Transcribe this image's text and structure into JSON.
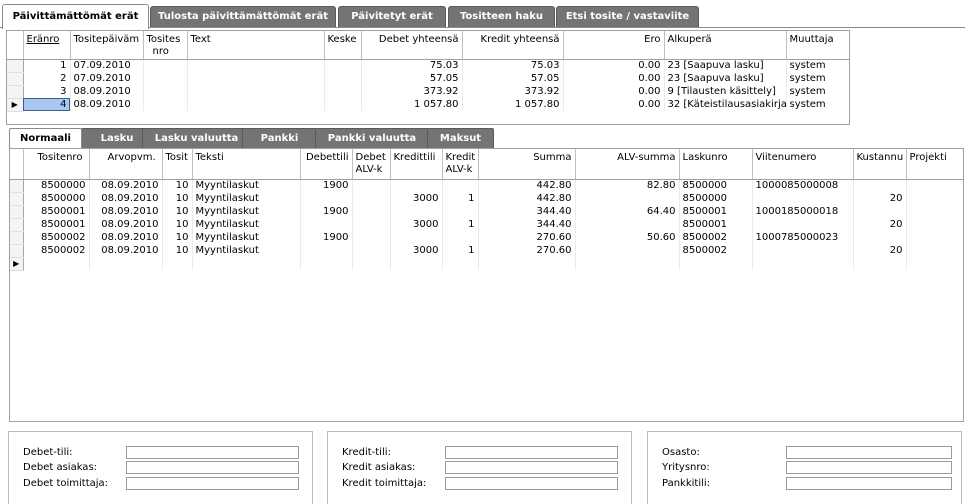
{
  "tabs": [
    {
      "label": "Päivittämättömät erät"
    },
    {
      "label": "Tulosta päivittämättömät erät"
    },
    {
      "label": "Päivitetyt erät"
    },
    {
      "label": "Tositteen haku"
    },
    {
      "label": "Etsi tosite / vastaviite"
    }
  ],
  "batch_grid": {
    "columns": {
      "erano": "Eränro",
      "date": "Tositepäiväm",
      "tosites": "Tosites",
      "tosites2": "nro",
      "text": "Text",
      "keske": "Keske",
      "debet": "Debet yhteensä",
      "kredit": "Kredit yhteensä",
      "ero": "Ero",
      "alkupera": "Alkuperä",
      "muuttaja": "Muuttaja"
    },
    "rows": [
      {
        "erano": "1",
        "date": "07.09.2010",
        "tosites": "",
        "text": "",
        "keske": "",
        "debet": "75.03",
        "kredit": "75.03",
        "ero": "0.00",
        "alkupera": "23 [Saapuva lasku]",
        "muuttaja": "system"
      },
      {
        "erano": "2",
        "date": "07.09.2010",
        "tosites": "",
        "text": "",
        "keske": "",
        "debet": "57.05",
        "kredit": "57.05",
        "ero": "0.00",
        "alkupera": "23 [Saapuva lasku]",
        "muuttaja": "system"
      },
      {
        "erano": "3",
        "date": "08.09.2010",
        "tosites": "",
        "text": "",
        "keske": "",
        "debet": "373.92",
        "kredit": "373.92",
        "ero": "0.00",
        "alkupera": "9 [Tilausten käsittely]",
        "muuttaja": "system"
      },
      {
        "erano": "4",
        "date": "08.09.2010",
        "tosites": "",
        "text": "",
        "keske": "",
        "debet": "1 057.80",
        "kredit": "1 057.80",
        "ero": "0.00",
        "alkupera": "32 [Käteistilausasiakirja]",
        "muuttaja": "system"
      }
    ]
  },
  "subtabs": [
    {
      "label": "Normaali"
    },
    {
      "label": "Lasku"
    },
    {
      "label": "Lasku valuutta"
    },
    {
      "label": "Pankki"
    },
    {
      "label": "Pankki valuutta"
    },
    {
      "label": "Maksut"
    }
  ],
  "entry_grid": {
    "columns": {
      "tositenro": "Tositenro",
      "arvopvm": "Arvopvm.",
      "tosit": "Tosit",
      "teksti": "Teksti",
      "debettili": "Debettili",
      "debet_alv_1": "Debet",
      "debet_alv_2": "ALV-k",
      "kredittili": "Kredittili",
      "kredit_alv_1": "Kredit",
      "kredit_alv_2": "ALV-k",
      "summa": "Summa",
      "alv_summa": "ALV-summa",
      "laskunro": "Laskunro",
      "viitenumero": "Viitenumero",
      "kustannus": "Kustannu",
      "projekti": "Projekti"
    },
    "rows": [
      {
        "tositenro": "8500000",
        "arvopvm": "08.09.2010",
        "tosit": "10",
        "teksti": "Myyntilaskut",
        "debettili": "1900",
        "debet_alv": "",
        "kredittili": "",
        "kredit_alv": "",
        "summa": "442.80",
        "alv_summa": "82.80",
        "laskunro": "8500000",
        "viitenumero": "1000085000008",
        "kustannus": "",
        "projekti": ""
      },
      {
        "tositenro": "8500000",
        "arvopvm": "08.09.2010",
        "tosit": "10",
        "teksti": "Myyntilaskut",
        "debettili": "",
        "debet_alv": "",
        "kredittili": "3000",
        "kredit_alv": "1",
        "summa": "442.80",
        "alv_summa": "",
        "laskunro": "8500000",
        "viitenumero": "",
        "kustannus": "20",
        "projekti": ""
      },
      {
        "tositenro": "8500001",
        "arvopvm": "08.09.2010",
        "tosit": "10",
        "teksti": "Myyntilaskut",
        "debettili": "1900",
        "debet_alv": "",
        "kredittili": "",
        "kredit_alv": "",
        "summa": "344.40",
        "alv_summa": "64.40",
        "laskunro": "8500001",
        "viitenumero": "1000185000018",
        "kustannus": "",
        "projekti": ""
      },
      {
        "tositenro": "8500001",
        "arvopvm": "08.09.2010",
        "tosit": "10",
        "teksti": "Myyntilaskut",
        "debettili": "",
        "debet_alv": "",
        "kredittili": "3000",
        "kredit_alv": "1",
        "summa": "344.40",
        "alv_summa": "",
        "laskunro": "8500001",
        "viitenumero": "",
        "kustannus": "20",
        "projekti": ""
      },
      {
        "tositenro": "8500002",
        "arvopvm": "08.09.2010",
        "tosit": "10",
        "teksti": "Myyntilaskut",
        "debettili": "1900",
        "debet_alv": "",
        "kredittili": "",
        "kredit_alv": "",
        "summa": "270.60",
        "alv_summa": "50.60",
        "laskunro": "8500002",
        "viitenumero": "1000785000023",
        "kustannus": "",
        "projekti": ""
      },
      {
        "tositenro": "8500002",
        "arvopvm": "08.09.2010",
        "tosit": "10",
        "teksti": "Myyntilaskut",
        "debettili": "",
        "debet_alv": "",
        "kredittili": "3000",
        "kredit_alv": "1",
        "summa": "270.60",
        "alv_summa": "",
        "laskunro": "8500002",
        "viitenumero": "",
        "kustannus": "20",
        "projekti": ""
      }
    ]
  },
  "panels": {
    "debet": {
      "tili": "Debet-tili:",
      "asiakas": "Debet asiakas:",
      "toimittaja": "Debet toimittaja:",
      "tili_value": "",
      "asiakas_value": "",
      "toimittaja_value": ""
    },
    "kredit": {
      "tili": "Kredit-tili:",
      "asiakas": "Kredit asiakas:",
      "toimittaja": "Kredit toimittaja:",
      "tili_value": "",
      "asiakas_value": "",
      "toimittaja_value": ""
    },
    "misc": {
      "osasto": "Osasto:",
      "yritysnro": "Yritysnro:",
      "pankkitili": "Pankkitili:",
      "osasto_value": "",
      "yritysnro_value": "",
      "pankkitili_value": ""
    }
  },
  "icons": {
    "current_row": "row-pointer-icon"
  }
}
